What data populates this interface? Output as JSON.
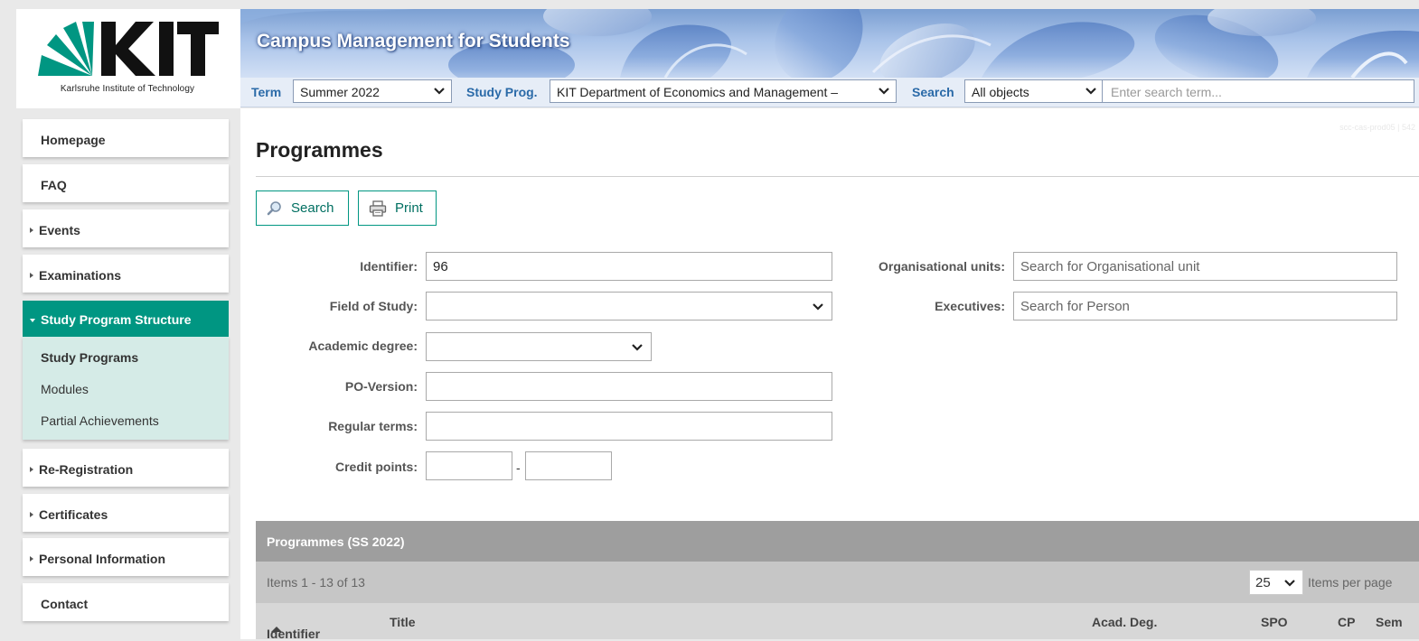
{
  "logo": {
    "text": "KIT",
    "tagline": "Karlsruhe Institute of Technology"
  },
  "banner": {
    "title": "Campus Management for Students"
  },
  "topbar": {
    "term_label": "Term",
    "term_value": "Summer 2022",
    "studyprog_label": "Study Prog.",
    "studyprog_value": "KIT Department of Economics and Management –",
    "search_label": "Search",
    "search_scope": "All objects",
    "search_placeholder": "Enter search term..."
  },
  "sidebar": {
    "items": [
      {
        "label": "Homepage",
        "arrow": false
      },
      {
        "label": "FAQ",
        "arrow": false
      },
      {
        "label": "Events",
        "arrow": true
      },
      {
        "label": "Examinations",
        "arrow": true
      },
      {
        "label": "Study Program Structure",
        "arrow": true,
        "active": true
      },
      {
        "label": "Re-Registration",
        "arrow": true
      },
      {
        "label": "Certificates",
        "arrow": true
      },
      {
        "label": "Personal Information",
        "arrow": true
      },
      {
        "label": "Contact",
        "arrow": false
      }
    ],
    "subitems": [
      {
        "label": "Study Programs",
        "current": true
      },
      {
        "label": "Modules"
      },
      {
        "label": "Partial Achievements"
      }
    ]
  },
  "main": {
    "title": "Programmes",
    "server_tag": "scc-cas-prod05 | 542",
    "buttons": {
      "search": "Search",
      "print": "Print"
    },
    "form": {
      "identifier_label": "Identifier:",
      "identifier_value": "96",
      "field_of_study_label": "Field of Study:",
      "field_of_study_value": "",
      "academic_degree_label": "Academic degree:",
      "academic_degree_value": "",
      "po_version_label": "PO-Version:",
      "po_version_value": "",
      "regular_terms_label": "Regular terms:",
      "regular_terms_value": "",
      "credit_points_label": "Credit points:",
      "credit_points_from": "",
      "credit_points_to": "",
      "credit_points_separator": "-",
      "org_units_label": "Organisational units:",
      "org_units_placeholder": "Search for Organisational unit",
      "executives_label": "Executives:",
      "executives_placeholder": "Search for Person"
    },
    "results": {
      "header": "Programmes (SS 2022)",
      "items_text": "Items 1 - 13 of 13",
      "per_page_value": "25",
      "per_page_label": "Items per page",
      "columns": [
        "Identifier",
        "Title",
        "Acad. Deg.",
        "SPO",
        "CP",
        "Sem"
      ]
    }
  },
  "colors": {
    "accent": "#009682",
    "link_blue": "#2a6aa8",
    "active_sub_bg": "#d5ebe7"
  }
}
